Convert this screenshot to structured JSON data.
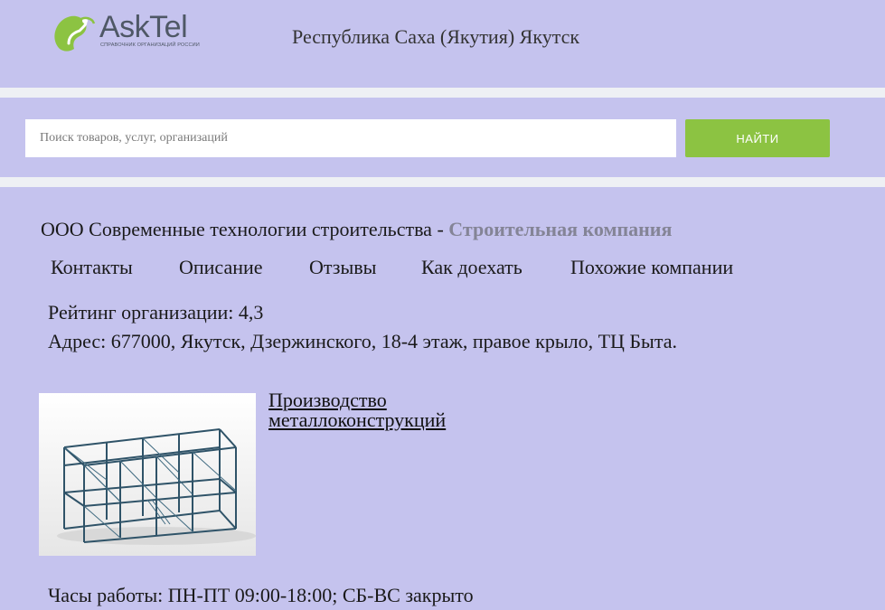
{
  "header": {
    "logo_text": "AskTel",
    "logo_subtitle": "СПРАВОЧНИК ОРГАНИЗАЦИЙ РОССИИ",
    "region": "Республика Саха (Якутия) Якутск"
  },
  "search": {
    "placeholder": "Поиск товаров, услуг, организаций",
    "button_label": "НАЙТИ"
  },
  "company": {
    "name": "ООО Современные технологии строительства - ",
    "category": "Строительная компания"
  },
  "tabs": [
    {
      "label": "Контакты"
    },
    {
      "label": "Описание"
    },
    {
      "label": "Отзывы"
    },
    {
      "label": "Как доехать"
    },
    {
      "label": "Похожие компании"
    }
  ],
  "info": {
    "rating": "Рейтинг организации: 4,3",
    "address": "Адрес: 677000, Якутск, Дзержинского, 18-4 этаж, правое крыло, ТЦ Быта.",
    "hours": "Часы работы: ПН-ПТ 09:00-18:00; СБ-ВС закрыто"
  },
  "product": {
    "title": "Производство металлоконструкций"
  },
  "colors": {
    "background": "#c5c3ee",
    "stripe": "#eef0f4",
    "button": "#8cc342",
    "logo_green": "#8cc342",
    "logo_text": "#4f5866",
    "category_text": "#848496"
  }
}
